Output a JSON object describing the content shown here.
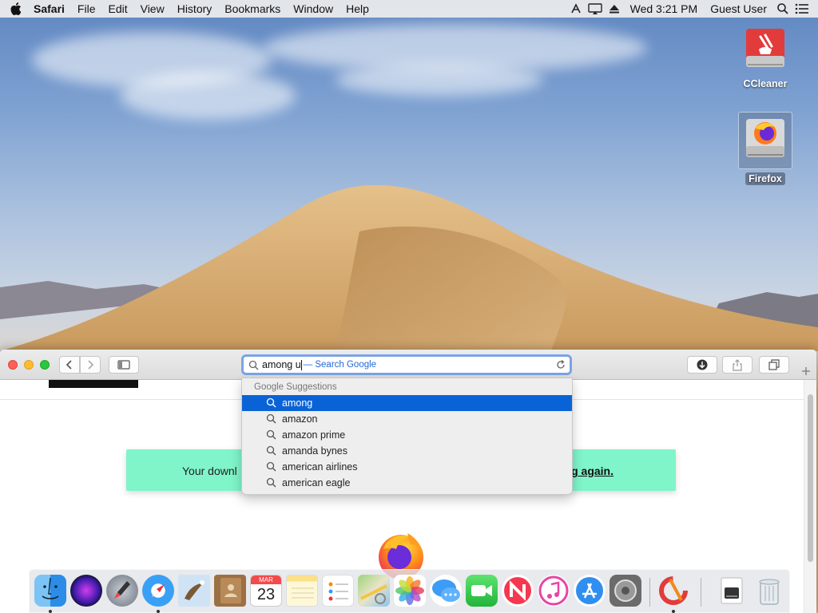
{
  "menubar": {
    "app_name": "Safari",
    "menus": [
      "File",
      "Edit",
      "View",
      "History",
      "Bookmarks",
      "Window",
      "Help"
    ],
    "clock": "Wed 3:21 PM",
    "user": "Guest User"
  },
  "desktop": {
    "icons": [
      {
        "label": "CCleaner",
        "icon": "ccleaner-drive-icon"
      },
      {
        "label": "Firefox",
        "icon": "firefox-disk-image-icon",
        "selected": true
      }
    ]
  },
  "safari": {
    "address": {
      "typed": "among u",
      "hint": "— Search Google"
    },
    "suggestions": {
      "header": "Google Suggestions",
      "items": [
        "among",
        "amazon",
        "amazon prime",
        "amanda bynes",
        "american airlines",
        "american eagle"
      ],
      "selected_index": 0
    },
    "page": {
      "banner_left": "Your downl",
      "banner_right": "g again."
    }
  },
  "dock": {
    "apps": [
      "Finder",
      "Siri",
      "Launchpad",
      "Safari",
      "Mail",
      "Contacts",
      "Calendar",
      "Notes",
      "Reminders",
      "Maps",
      "Photos",
      "Messages",
      "FaceTime",
      "News",
      "iTunes",
      "App Store",
      "System Preferences",
      "CCleaner",
      "Firefox Disk",
      "Trash"
    ],
    "calendar_month": "MAR",
    "calendar_day": "23"
  },
  "colors": {
    "selection_blue": "#0a63d6",
    "banner_green": "#7ff5c9",
    "url_focus_ring": "#7ba4e6"
  }
}
